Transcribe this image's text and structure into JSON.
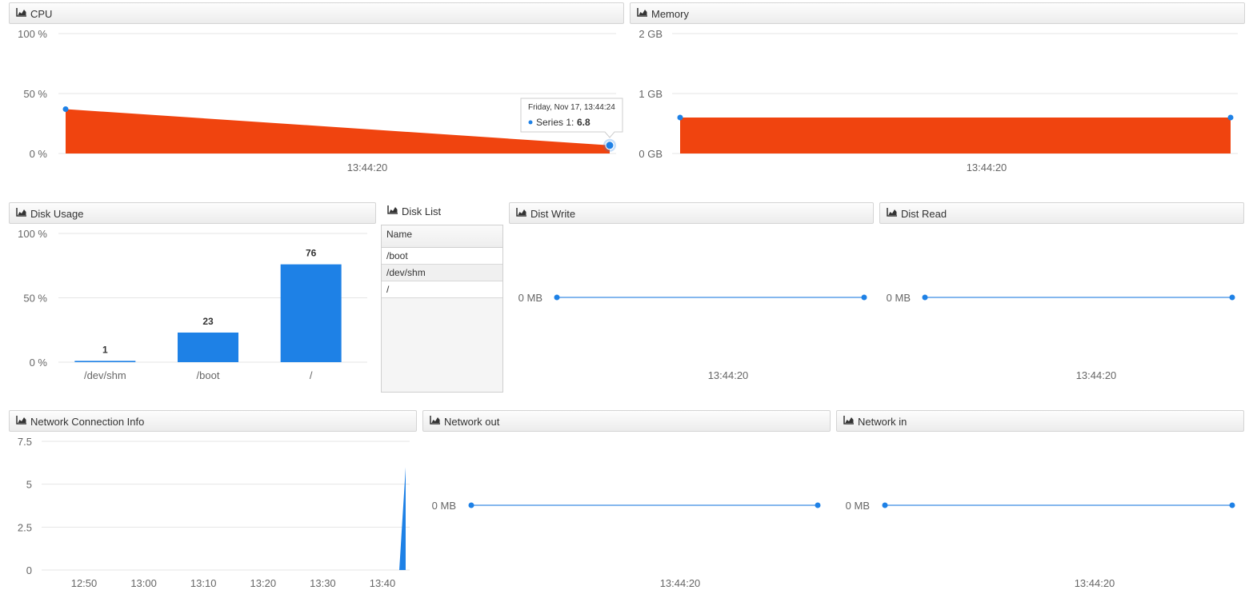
{
  "colors": {
    "orange": "#f0440f",
    "blue": "#1e81e6",
    "line": "#5b9fe8"
  },
  "icons": {
    "panel": "area-chart-icon"
  },
  "panels": {
    "cpu": {
      "title": "CPU"
    },
    "memory": {
      "title": "Memory"
    },
    "disk_usage": {
      "title": "Disk Usage"
    },
    "disk_list": {
      "title": "Disk List",
      "column": "Name",
      "rows": [
        "/boot",
        "/dev/shm",
        "/"
      ]
    },
    "disk_write": {
      "title": "Dist Write"
    },
    "disk_read": {
      "title": "Dist Read"
    },
    "network_conn": {
      "title": "Network Connection Info"
    },
    "network_out": {
      "title": "Network out"
    },
    "network_in": {
      "title": "Network in"
    }
  },
  "tooltip": {
    "date": "Friday, Nov 17, 13:44:24",
    "series": "Series 1",
    "value": "6.8"
  },
  "chart_data": [
    {
      "id": "cpu",
      "type": "area",
      "x": [
        "13:44:20",
        "13:44:24"
      ],
      "values": [
        37,
        6.8
      ],
      "ylim": [
        0,
        100
      ],
      "yticks": [
        "0 %",
        "50 %",
        "100 %"
      ],
      "xtick": "13:44:20",
      "grid": true
    },
    {
      "id": "memory",
      "type": "area",
      "values": [
        0.6,
        0.6
      ],
      "ylim": [
        0,
        2
      ],
      "yticks": [
        "0 GB",
        "1 GB",
        "2 GB"
      ],
      "xtick": "13:44:20",
      "grid": true
    },
    {
      "id": "disk_usage",
      "type": "bar",
      "categories": [
        "/dev/shm",
        "/boot",
        "/"
      ],
      "values": [
        1,
        23,
        76
      ],
      "ylim": [
        0,
        100
      ],
      "yticks": [
        "0 %",
        "50 %",
        "100 %"
      ],
      "grid": true
    },
    {
      "id": "disk_write",
      "type": "line",
      "values": [
        0,
        0
      ],
      "ytick": "0 MB",
      "xtick": "13:44:20"
    },
    {
      "id": "disk_read",
      "type": "line",
      "values": [
        0,
        0
      ],
      "ytick": "0 MB",
      "xtick": "13:44:20"
    },
    {
      "id": "network_conn",
      "type": "area",
      "x": [
        "12:50",
        "13:00",
        "13:10",
        "13:20",
        "13:30",
        "13:40"
      ],
      "yticks": [
        "0",
        "2.5",
        "5",
        "7.5"
      ],
      "ylim": [
        0,
        7.5
      ],
      "spike_value": 6,
      "grid": true
    },
    {
      "id": "network_out",
      "type": "line",
      "values": [
        0,
        0
      ],
      "ytick": "0 MB",
      "xtick": "13:44:20"
    },
    {
      "id": "network_in",
      "type": "line",
      "values": [
        0,
        0
      ],
      "ytick": "0 MB",
      "xtick": "13:44:20"
    }
  ]
}
